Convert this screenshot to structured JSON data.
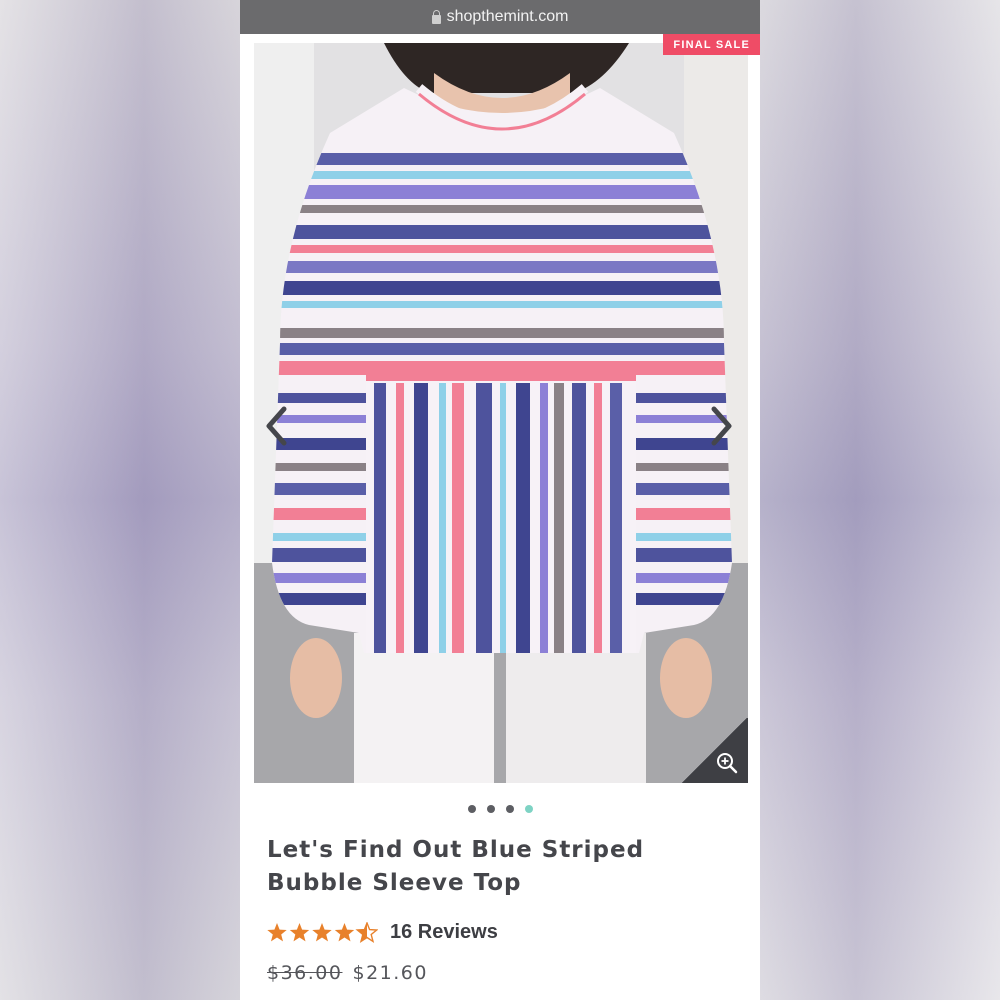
{
  "browser": {
    "url": "shopthemint.com"
  },
  "badge": {
    "label": "FINAL SALE"
  },
  "gallery": {
    "total_images": 4,
    "active_index": 3
  },
  "product": {
    "title": "Let's Find Out Blue Striped Bubble Sleeve Top",
    "rating": 4.5,
    "reviews_label": "16 Reviews",
    "price_original": "$36.00",
    "price_sale": "$21.60"
  },
  "colors": {
    "badge": "#ef4c66",
    "star": "#e8812b",
    "active_dot": "#7ed3c4",
    "title": "#45464b"
  }
}
